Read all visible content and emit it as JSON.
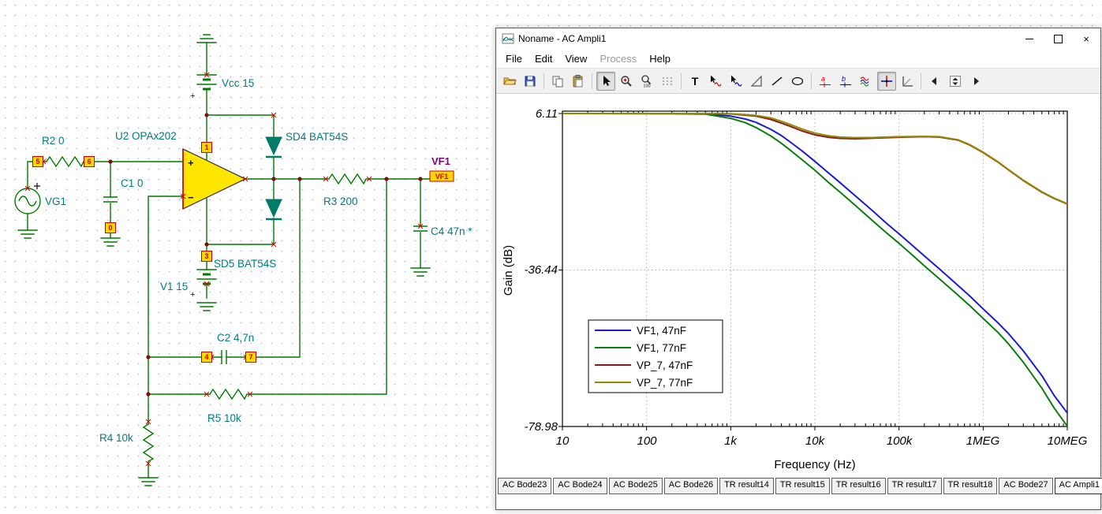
{
  "window": {
    "title": "Noname - AC Ampli1",
    "menu": [
      {
        "label": "File",
        "disabled": false
      },
      {
        "label": "Edit",
        "disabled": false
      },
      {
        "label": "View",
        "disabled": false
      },
      {
        "label": "Process",
        "disabled": true
      },
      {
        "label": "Help",
        "disabled": false
      }
    ]
  },
  "icons": {
    "tab_scroll_left": "◀",
    "tab_scroll_right": "▶",
    "close_glyph": "×"
  },
  "toolbar": {
    "text_tool_label": "T",
    "zoom_100_label": "100",
    "marker_a_label": "a",
    "marker_b_label": "b"
  },
  "tabs": {
    "items": [
      "AC Bode23",
      "AC Bode24",
      "AC Bode25",
      "AC Bode26",
      "TR result14",
      "TR result15",
      "TR result16",
      "TR result17",
      "TR result18",
      "AC Bode27",
      "AC Ampli1"
    ],
    "active": "AC Ampli1"
  },
  "schematic": {
    "labels": {
      "vg1": "VG1",
      "r2": "R2 0",
      "c1": "C1 0",
      "u2": "U2 OPAx202",
      "vcc": "Vcc 15",
      "sd4": "SD4 BAT54S",
      "sd5": "SD5 BAT54S",
      "v1": "V1 15",
      "r3": "R3 200",
      "c4": "C4 47n *",
      "c2": "C2 4,7n",
      "r5": "R5 10k",
      "r4": "R4 10k",
      "vf1_net": "VF1",
      "vf1_tag": "VF1",
      "plus": "+",
      "minus": "−"
    },
    "pin_tags": {
      "t5": "5",
      "t6": "6",
      "t0": "0",
      "t1": "1",
      "t3": "3",
      "t4": "4",
      "t7": "7"
    }
  },
  "chart_data": {
    "type": "line",
    "title": "",
    "xlabel": "Frequency (Hz)",
    "ylabel": "Gain (dB)",
    "x_scale": "log",
    "xlim": [
      10,
      10000000
    ],
    "ylim": [
      -78.98,
      6.11
    ],
    "y_ticks": [
      6.11,
      -36.44,
      -78.98
    ],
    "y_tick_labels": [
      "6.11",
      "-36.44",
      "-78.98"
    ],
    "x_tick_labels": [
      "10",
      "100",
      "1k",
      "10k",
      "100k",
      "1MEG",
      "10MEG"
    ],
    "grid": "dotted",
    "legend_position": "inside-lower-left",
    "series": [
      {
        "name": "VF1, 47nF",
        "color": "#1a1ad6",
        "points": [
          [
            10,
            6.11
          ],
          [
            200,
            6.09
          ],
          [
            500,
            6.0
          ],
          [
            1000,
            5.4
          ],
          [
            1500,
            4.6
          ],
          [
            2000,
            3.7
          ],
          [
            3000,
            1.8
          ],
          [
            4000,
            0.1
          ],
          [
            5000,
            -1.5
          ],
          [
            7000,
            -4.0
          ],
          [
            10000,
            -6.9
          ],
          [
            15000,
            -10.3
          ],
          [
            20000,
            -12.7
          ],
          [
            30000,
            -16.2
          ],
          [
            50000,
            -20.6
          ],
          [
            70000,
            -23.6
          ],
          [
            100000,
            -26.6
          ],
          [
            150000,
            -30.1
          ],
          [
            200000,
            -32.6
          ],
          [
            300000,
            -36.1
          ],
          [
            500000,
            -40.6
          ],
          [
            700000,
            -43.6
          ],
          [
            1000000,
            -47.0
          ],
          [
            1500000,
            -50.8
          ],
          [
            2000000,
            -53.7
          ],
          [
            3000000,
            -58.4
          ],
          [
            5000000,
            -65.2
          ],
          [
            7000000,
            -70.6
          ],
          [
            10000000,
            -75.3
          ]
        ]
      },
      {
        "name": "VF1, 77nF",
        "color": "#0b7d0b",
        "points": [
          [
            10,
            6.11
          ],
          [
            200,
            6.07
          ],
          [
            500,
            5.93
          ],
          [
            1000,
            4.8
          ],
          [
            1500,
            3.6
          ],
          [
            2000,
            2.3
          ],
          [
            3000,
            0.0
          ],
          [
            4000,
            -2.0
          ],
          [
            5000,
            -3.7
          ],
          [
            7000,
            -6.4
          ],
          [
            10000,
            -9.3
          ],
          [
            15000,
            -12.9
          ],
          [
            20000,
            -15.3
          ],
          [
            30000,
            -18.8
          ],
          [
            50000,
            -23.3
          ],
          [
            70000,
            -26.2
          ],
          [
            100000,
            -29.2
          ],
          [
            150000,
            -32.7
          ],
          [
            200000,
            -35.3
          ],
          [
            300000,
            -38.8
          ],
          [
            500000,
            -43.2
          ],
          [
            700000,
            -46.2
          ],
          [
            1000000,
            -49.6
          ],
          [
            1500000,
            -53.4
          ],
          [
            2000000,
            -56.5
          ],
          [
            3000000,
            -61.5
          ],
          [
            5000000,
            -68.6
          ],
          [
            7000000,
            -74.0
          ],
          [
            10000000,
            -78.9
          ]
        ]
      },
      {
        "name": "VP_7, 47nF",
        "color": "#8b1a1a",
        "points": [
          [
            10,
            6.11
          ],
          [
            500,
            6.11
          ],
          [
            1000,
            6.0
          ],
          [
            2000,
            5.4
          ],
          [
            3000,
            4.5
          ],
          [
            4000,
            3.5
          ],
          [
            5000,
            2.7
          ],
          [
            7000,
            1.4
          ],
          [
            10000,
            0.3
          ],
          [
            15000,
            -0.4
          ],
          [
            20000,
            -0.65
          ],
          [
            30000,
            -0.75
          ],
          [
            50000,
            -0.6
          ],
          [
            100000,
            -0.35
          ],
          [
            200000,
            -0.2
          ],
          [
            300000,
            -0.3
          ],
          [
            500000,
            -1.1
          ],
          [
            700000,
            -2.5
          ],
          [
            1000000,
            -4.5
          ],
          [
            1500000,
            -7.1
          ],
          [
            2000000,
            -9.2
          ],
          [
            3000000,
            -12.1
          ],
          [
            5000000,
            -15.3
          ],
          [
            7000000,
            -17.0
          ],
          [
            10000000,
            -18.5
          ]
        ]
      },
      {
        "name": "VP_7, 77nF",
        "color": "#948900",
        "points": [
          [
            10,
            6.11
          ],
          [
            500,
            6.11
          ],
          [
            1000,
            6.05
          ],
          [
            2000,
            5.6
          ],
          [
            3000,
            4.9
          ],
          [
            4000,
            4.0
          ],
          [
            5000,
            3.2
          ],
          [
            7000,
            1.9
          ],
          [
            10000,
            0.8
          ],
          [
            15000,
            0.0
          ],
          [
            20000,
            -0.3
          ],
          [
            30000,
            -0.45
          ],
          [
            50000,
            -0.4
          ],
          [
            100000,
            -0.2
          ],
          [
            200000,
            -0.1
          ],
          [
            300000,
            -0.2
          ],
          [
            500000,
            -1.0
          ],
          [
            700000,
            -2.4
          ],
          [
            1000000,
            -4.4
          ],
          [
            1500000,
            -7.0
          ],
          [
            2000000,
            -9.1
          ],
          [
            3000000,
            -12.0
          ],
          [
            5000000,
            -15.2
          ],
          [
            7000000,
            -16.9
          ],
          [
            10000000,
            -18.4
          ]
        ]
      }
    ]
  }
}
